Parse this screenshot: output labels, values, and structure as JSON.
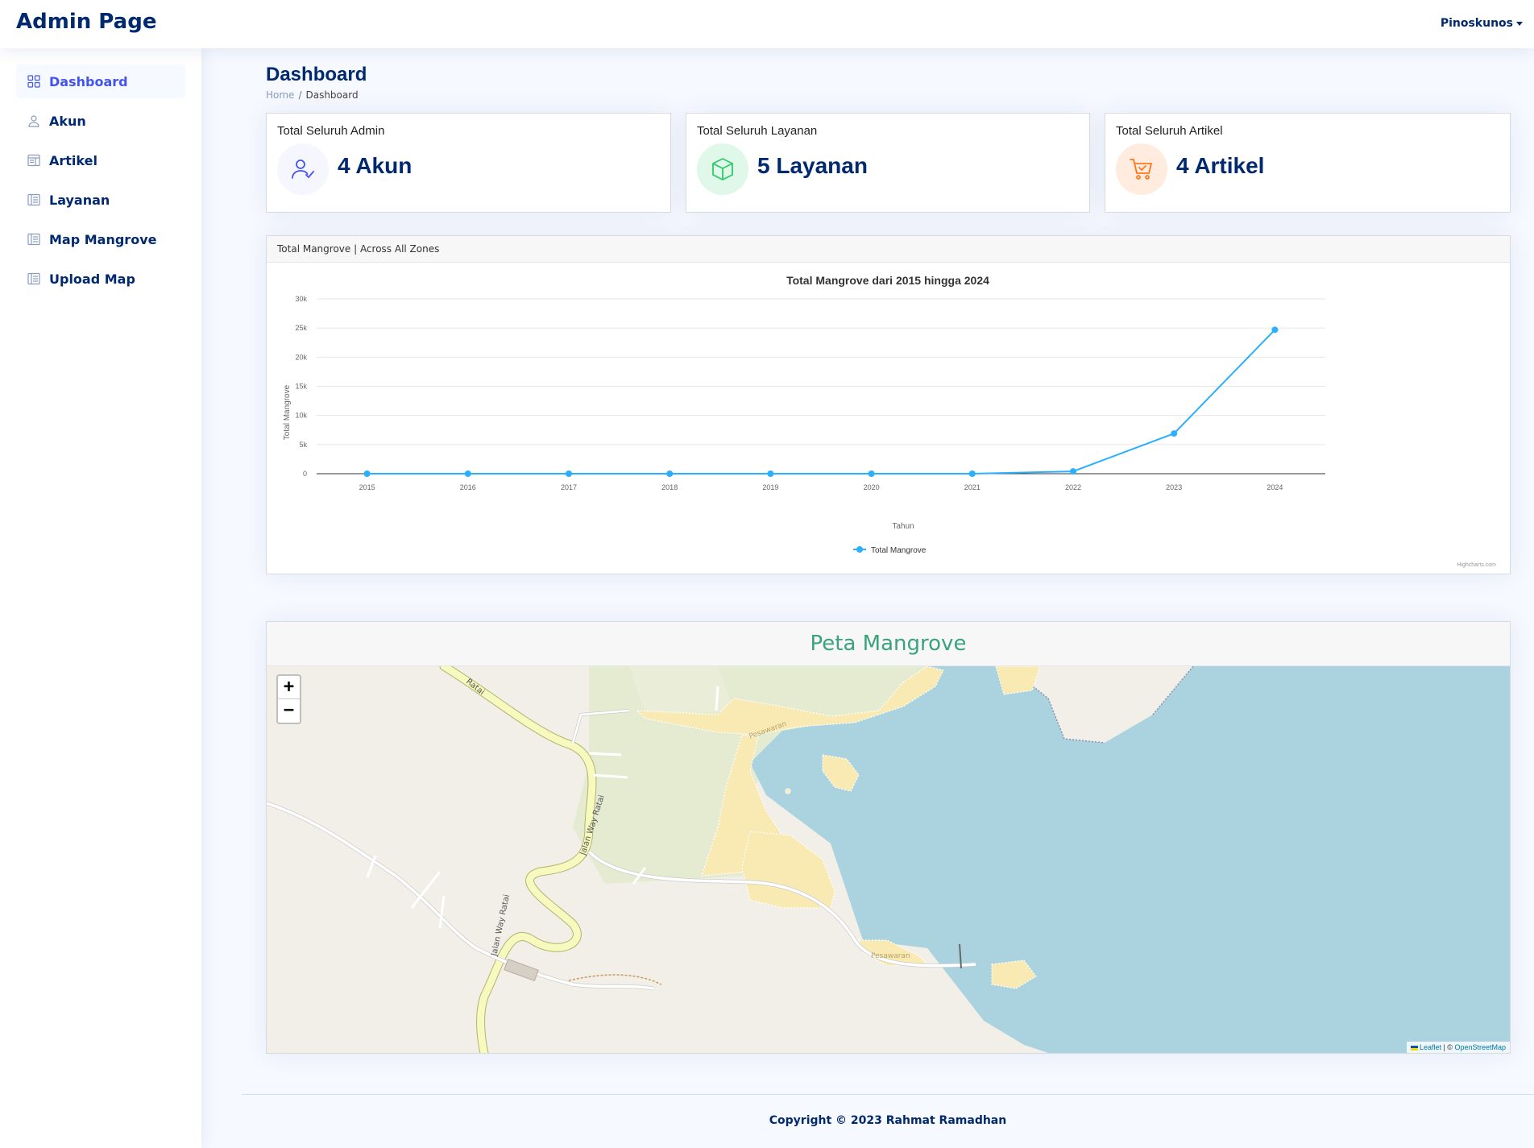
{
  "header": {
    "logo": "Admin Page",
    "user_name": "Pinoskunos"
  },
  "sidebar": {
    "items": [
      {
        "label": "Dashboard",
        "icon": "grid-icon",
        "active": true
      },
      {
        "label": "Akun",
        "icon": "person-icon"
      },
      {
        "label": "Artikel",
        "icon": "layout-text-window-icon"
      },
      {
        "label": "Layanan",
        "icon": "layout-text-sidebar-icon"
      },
      {
        "label": "Map Mangrove",
        "icon": "layout-text-sidebar-icon"
      },
      {
        "label": "Upload Map",
        "icon": "layout-text-sidebar-icon"
      }
    ]
  },
  "page": {
    "title": "Dashboard",
    "breadcrumb": [
      "Home",
      "Dashboard"
    ]
  },
  "stats": [
    {
      "title": "Total Seluruh Admin",
      "value": "4 Akun",
      "icon": "people-check-icon",
      "color": "#4154f1",
      "bg": "#f6f6fe"
    },
    {
      "title": "Total Seluruh Layanan",
      "value": "5 Layanan",
      "icon": "box-icon",
      "color": "#2eca6a",
      "bg": "#e0f8e9"
    },
    {
      "title": "Total Seluruh Artikel",
      "value": "4 Artikel",
      "icon": "cart-check-icon",
      "color": "#ff771d",
      "bg": "#ffecdf"
    }
  ],
  "chart_card": {
    "title": "Total Mangrove | Across All Zones"
  },
  "chart_data": {
    "type": "line",
    "title": "Total Mangrove dari 2015 hingga 2024",
    "xlabel": "Tahun",
    "ylabel": "Total Mangrove",
    "categories": [
      "2015",
      "2016",
      "2017",
      "2018",
      "2019",
      "2020",
      "2021",
      "2022",
      "2023",
      "2024"
    ],
    "series": [
      {
        "name": "Total Mangrove",
        "values": [
          0,
          0,
          0,
          0,
          0,
          0,
          0,
          400,
          6900,
          24700
        ],
        "color": "#2caffe"
      }
    ],
    "ylim": [
      0,
      30000
    ],
    "yticks": [
      "0",
      "5k",
      "10k",
      "15k",
      "20k",
      "25k",
      "30k"
    ],
    "ytick_values": [
      0,
      5000,
      10000,
      15000,
      20000,
      25000,
      30000
    ],
    "grid": true,
    "legend_position": "bottom-center",
    "credits": "Highcharts.com"
  },
  "map_card": {
    "title": "Peta Mangrove",
    "zoom_in": "+",
    "zoom_out": "−",
    "attribution_leaflet": "Leaflet",
    "attribution_sep": " | © ",
    "attribution_osm": "OpenStreetMap",
    "labels": {
      "road1": "Jalan Way Ratai",
      "road2": "Jalan Way Ratai",
      "road3": "Ratai",
      "place1": "Pesawaran",
      "place2": "Pesawaran"
    },
    "colors": {
      "water": "#aad3df",
      "land": "#f2efe9",
      "sand": "#f9e9b2",
      "grass": "#e5ebd0",
      "road": "#f7fabf"
    }
  },
  "footer": {
    "text": "Copyright © 2023 Rahmat Ramadhan"
  }
}
